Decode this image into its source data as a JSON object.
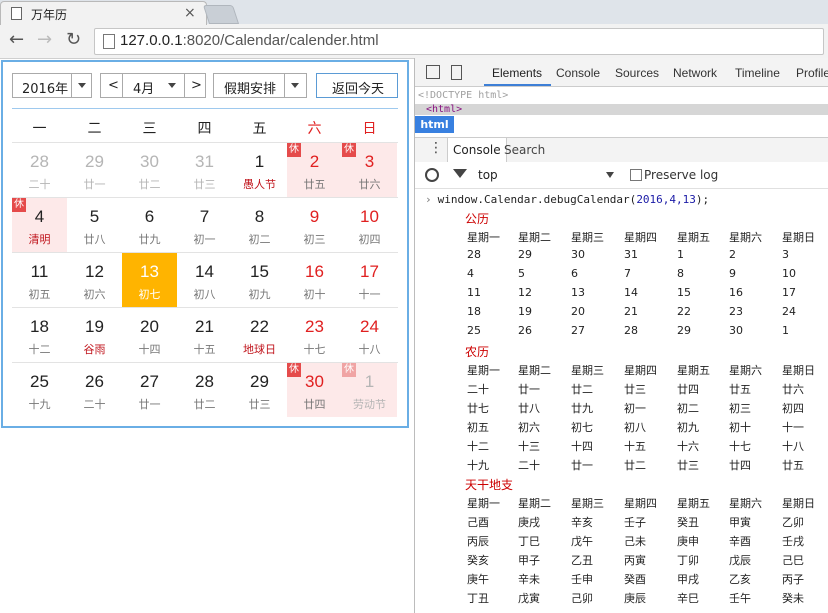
{
  "browser": {
    "tab_title": "万年历",
    "url_host": "127.0.0.1",
    "url_rest": ":8020/Calendar/calender.html"
  },
  "calendar": {
    "year_select": "2016年",
    "month_prev": "<",
    "month_select": "4月",
    "month_next": ">",
    "holiday_select": "假期安排",
    "today_button": "返回今天",
    "weekdays": [
      "一",
      "二",
      "三",
      "四",
      "五",
      "六",
      "日"
    ],
    "rest_badge": "休",
    "weeks": [
      [
        {
          "d": "28",
          "l": "二十",
          "state": "gray"
        },
        {
          "d": "29",
          "l": "廿一",
          "state": "gray"
        },
        {
          "d": "30",
          "l": "廿二",
          "state": "gray"
        },
        {
          "d": "31",
          "l": "廿三",
          "state": "gray"
        },
        {
          "d": "1",
          "l": "愚人节",
          "state": "fest"
        },
        {
          "d": "2",
          "l": "廿五",
          "state": "red-rest"
        },
        {
          "d": "3",
          "l": "廿六",
          "state": "red-rest"
        }
      ],
      [
        {
          "d": "4",
          "l": "清明",
          "state": "rest-fest"
        },
        {
          "d": "5",
          "l": "廿八",
          "state": ""
        },
        {
          "d": "6",
          "l": "廿九",
          "state": ""
        },
        {
          "d": "7",
          "l": "初一",
          "state": ""
        },
        {
          "d": "8",
          "l": "初二",
          "state": ""
        },
        {
          "d": "9",
          "l": "初三",
          "state": "red"
        },
        {
          "d": "10",
          "l": "初四",
          "state": "red"
        }
      ],
      [
        {
          "d": "11",
          "l": "初五",
          "state": ""
        },
        {
          "d": "12",
          "l": "初六",
          "state": ""
        },
        {
          "d": "13",
          "l": "初七",
          "state": "today"
        },
        {
          "d": "14",
          "l": "初八",
          "state": ""
        },
        {
          "d": "15",
          "l": "初九",
          "state": ""
        },
        {
          "d": "16",
          "l": "初十",
          "state": "red"
        },
        {
          "d": "17",
          "l": "十一",
          "state": "red"
        }
      ],
      [
        {
          "d": "18",
          "l": "十二",
          "state": ""
        },
        {
          "d": "19",
          "l": "谷雨",
          "state": "fest"
        },
        {
          "d": "20",
          "l": "十四",
          "state": ""
        },
        {
          "d": "21",
          "l": "十五",
          "state": ""
        },
        {
          "d": "22",
          "l": "地球日",
          "state": "fest"
        },
        {
          "d": "23",
          "l": "十七",
          "state": "red"
        },
        {
          "d": "24",
          "l": "十八",
          "state": "red"
        }
      ],
      [
        {
          "d": "25",
          "l": "十九",
          "state": ""
        },
        {
          "d": "26",
          "l": "二十",
          "state": ""
        },
        {
          "d": "27",
          "l": "廿一",
          "state": ""
        },
        {
          "d": "28",
          "l": "廿二",
          "state": ""
        },
        {
          "d": "29",
          "l": "廿三",
          "state": ""
        },
        {
          "d": "30",
          "l": "廿四",
          "state": "red-rest"
        },
        {
          "d": "1",
          "l": "劳动节",
          "state": "gray-rest-fest"
        }
      ]
    ]
  },
  "devtools": {
    "tabs": [
      "Elements",
      "Console",
      "Sources",
      "Network",
      "Timeline",
      "Profile"
    ],
    "doctype_line": "<!DOCTYPE html>",
    "html_line": "<html>",
    "crumb": "html",
    "drawer_tabs": [
      "Console",
      "Search"
    ],
    "context": "top",
    "preserve_log": "Preserve log",
    "command_prefix": "window.Calendar.debugCalendar(",
    "command_args": "2016,4,13",
    "command_suffix": ");",
    "headers": [
      "星期一",
      "星期二",
      "星期三",
      "星期四",
      "星期五",
      "星期六",
      "星期日"
    ],
    "sections": [
      {
        "title": "公历",
        "rows": [
          [
            "28",
            "29",
            "30",
            "31",
            "1",
            "2",
            "3"
          ],
          [
            "4",
            "5",
            "6",
            "7",
            "8",
            "9",
            "10"
          ],
          [
            "11",
            "12",
            "13",
            "14",
            "15",
            "16",
            "17"
          ],
          [
            "18",
            "19",
            "20",
            "21",
            "22",
            "23",
            "24"
          ],
          [
            "25",
            "26",
            "27",
            "28",
            "29",
            "30",
            "1"
          ]
        ]
      },
      {
        "title": "农历",
        "rows": [
          [
            "二十",
            "廿一",
            "廿二",
            "廿三",
            "廿四",
            "廿五",
            "廿六"
          ],
          [
            "廿七",
            "廿八",
            "廿九",
            "初一",
            "初二",
            "初三",
            "初四"
          ],
          [
            "初五",
            "初六",
            "初七",
            "初八",
            "初九",
            "初十",
            "十一"
          ],
          [
            "十二",
            "十三",
            "十四",
            "十五",
            "十六",
            "十七",
            "十八"
          ],
          [
            "十九",
            "二十",
            "廿一",
            "廿二",
            "廿三",
            "廿四",
            "廿五"
          ]
        ]
      },
      {
        "title": "天干地支",
        "rows": [
          [
            "己酉",
            "庚戌",
            "辛亥",
            "壬子",
            "癸丑",
            "甲寅",
            "乙卯"
          ],
          [
            "丙辰",
            "丁巳",
            "戊午",
            "己未",
            "庚申",
            "辛酉",
            "壬戌"
          ],
          [
            "癸亥",
            "甲子",
            "乙丑",
            "丙寅",
            "丁卯",
            "戊辰",
            "己巳"
          ],
          [
            "庚午",
            "辛未",
            "壬申",
            "癸酉",
            "甲戌",
            "乙亥",
            "丙子"
          ],
          [
            "丁丑",
            "戊寅",
            "己卯",
            "庚辰",
            "辛巳",
            "壬午",
            "癸未"
          ]
        ]
      }
    ]
  }
}
